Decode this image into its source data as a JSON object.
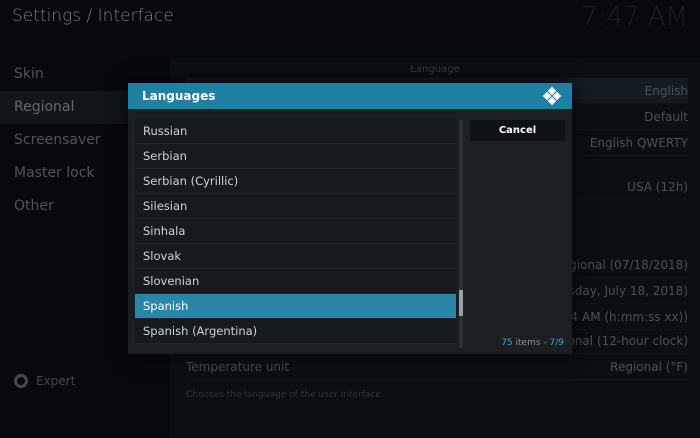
{
  "header": {
    "title": "Settings / Interface",
    "clock": "7:47 AM"
  },
  "sidebar": {
    "items": [
      {
        "label": "Skin"
      },
      {
        "label": "Regional"
      },
      {
        "label": "Screensaver"
      },
      {
        "label": "Master lock"
      },
      {
        "label": "Other"
      }
    ],
    "footer_label": "Expert"
  },
  "background": {
    "group_header": "Language",
    "rows": [
      {
        "label": "",
        "value": "English"
      },
      {
        "label": "",
        "value": "Default"
      },
      {
        "label": "",
        "value": "English QWERTY"
      },
      {
        "label": "",
        "value": "USA (12h)"
      },
      {
        "label": "",
        "value": "Regional (07/18/2018)"
      },
      {
        "label": "",
        "value": "Wednesday, July 18, 2018)"
      },
      {
        "label": "",
        "value": "7:34 AM (h:mm:ss xx))"
      },
      {
        "label": "",
        "value": "Regional (12-hour clock)"
      },
      {
        "label": "Temperature unit",
        "value": "Regional (°F)"
      }
    ],
    "description": "Chooses the language of the user interface."
  },
  "dialog": {
    "title": "Languages",
    "items": [
      "Russian",
      "Serbian",
      "Serbian (Cyrillic)",
      "Silesian",
      "Sinhala",
      "Slovak",
      "Slovenian",
      "Spanish",
      "Spanish (Argentina)"
    ],
    "focused_index": 7,
    "cancel_label": "Cancel",
    "count_number": "75",
    "count_text": " items - ",
    "page": "7/9"
  },
  "colors": {
    "accent": "#2a85a8",
    "header": "#1e80a3"
  }
}
